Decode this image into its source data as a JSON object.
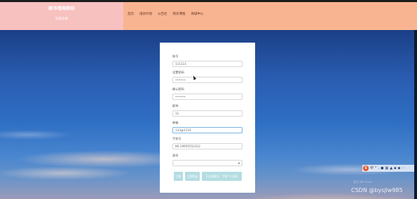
{
  "site": {
    "title": "图书借阅网站",
    "subtitle": "欢迎注册"
  },
  "nav": {
    "items": [
      "首页",
      "培训计划",
      "公告栏",
      "购买课程",
      "商城中心"
    ]
  },
  "form": {
    "fields": [
      {
        "label": "账号",
        "value": "111111"
      },
      {
        "label": "设置密码",
        "value": "••••••"
      },
      {
        "label": "确认密码",
        "value": "••••••"
      },
      {
        "label": "昵称",
        "value": "11"
      },
      {
        "label": "邮箱",
        "value": "133@1231"
      },
      {
        "label": "手机号",
        "value": "86 19955552312"
      },
      {
        "label": "身份",
        "value": ""
      }
    ],
    "buttons": [
      "注册",
      "立即登录",
      "已注册账号，下载个人资料"
    ]
  },
  "tray": {
    "s_label": "S",
    "icons": [
      "中",
      "°",
      ",",
      "mic",
      "kbd",
      "shirt",
      "grid",
      "chat",
      "dots"
    ]
  },
  "watermark": "CSDN @bysjlw985",
  "faint_watermark": "激活 Windows"
}
